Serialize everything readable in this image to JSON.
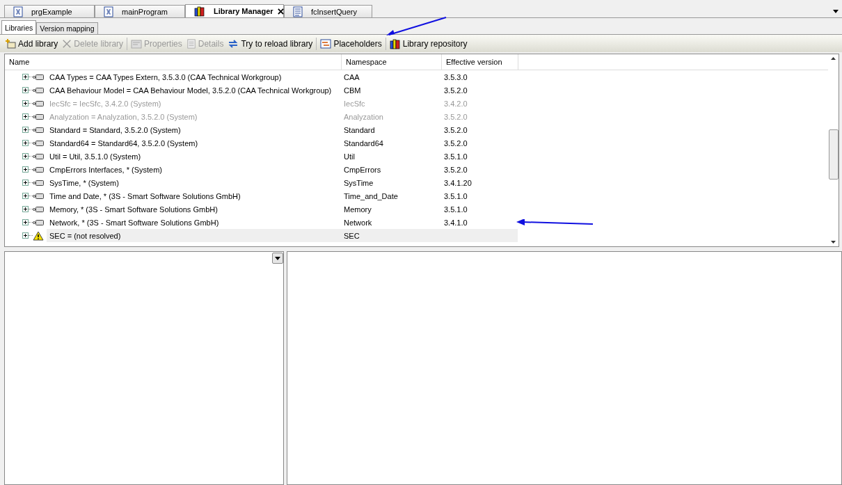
{
  "editor_tabs": [
    {
      "label": "prgExample",
      "kind": "program",
      "selected": false
    },
    {
      "label": "mainProgram",
      "kind": "program",
      "selected": false
    },
    {
      "label": "Library Manager",
      "kind": "library",
      "selected": true
    },
    {
      "label": "fcInsertQuery",
      "kind": "document",
      "selected": false
    }
  ],
  "sub_tabs": [
    {
      "label": "Libraries",
      "selected": true
    },
    {
      "label": "Version mapping",
      "selected": false
    }
  ],
  "toolbar": [
    {
      "label": "Add library",
      "kind": "add",
      "disabled": false
    },
    {
      "label": "Delete library",
      "kind": "delete",
      "disabled": true
    },
    {
      "label": "Properties",
      "kind": "properties",
      "disabled": true
    },
    {
      "label": "Details",
      "kind": "details",
      "disabled": true
    },
    {
      "label": "Try to reload library",
      "kind": "reload",
      "disabled": false
    },
    {
      "label": "Placeholders",
      "kind": "placeholders",
      "disabled": false
    },
    {
      "label": "Library repository",
      "kind": "repository",
      "disabled": false
    }
  ],
  "table": {
    "columns": [
      "Name",
      "Namespace",
      "Effective version"
    ],
    "rows": [
      {
        "name": "CAA Types = CAA Types Extern, 3.5.3.0 (CAA Technical Workgroup)",
        "namespace": "CAA",
        "version": "3.5.3.0",
        "kind": "library",
        "disabled": false,
        "selected": false
      },
      {
        "name": "CAA Behaviour Model = CAA Behaviour Model, 3.5.2.0 (CAA Technical Workgroup)",
        "namespace": "CBM",
        "version": "3.5.2.0",
        "kind": "library",
        "disabled": false,
        "selected": false
      },
      {
        "name": "IecSfc = IecSfc, 3.4.2.0 (System)",
        "namespace": "IecSfc",
        "version": "3.4.2.0",
        "kind": "library",
        "disabled": true,
        "selected": false
      },
      {
        "name": "Analyzation = Analyzation, 3.5.2.0 (System)",
        "namespace": "Analyzation",
        "version": "3.5.2.0",
        "kind": "library",
        "disabled": true,
        "selected": false
      },
      {
        "name": "Standard = Standard, 3.5.2.0 (System)",
        "namespace": "Standard",
        "version": "3.5.2.0",
        "kind": "library",
        "disabled": false,
        "selected": false
      },
      {
        "name": "Standard64 = Standard64, 3.5.2.0 (System)",
        "namespace": "Standard64",
        "version": "3.5.2.0",
        "kind": "library",
        "disabled": false,
        "selected": false
      },
      {
        "name": "Util = Util, 3.5.1.0 (System)",
        "namespace": "Util",
        "version": "3.5.1.0",
        "kind": "library",
        "disabled": false,
        "selected": false
      },
      {
        "name": "CmpErrors Interfaces, * (System)",
        "namespace": "CmpErrors",
        "version": "3.5.2.0",
        "kind": "library",
        "disabled": false,
        "selected": false
      },
      {
        "name": "SysTime, * (System)",
        "namespace": "SysTime",
        "version": "3.4.1.20",
        "kind": "library",
        "disabled": false,
        "selected": false
      },
      {
        "name": "Time and Date, * (3S - Smart Software Solutions GmbH)",
        "namespace": "Time_and_Date",
        "version": "3.5.1.0",
        "kind": "library",
        "disabled": false,
        "selected": false
      },
      {
        "name": "Memory, * (3S - Smart Software Solutions GmbH)",
        "namespace": "Memory",
        "version": "3.5.1.0",
        "kind": "library",
        "disabled": false,
        "selected": false
      },
      {
        "name": "Network, * (3S - Smart Software Solutions GmbH)",
        "namespace": "Network",
        "version": "3.4.1.0",
        "kind": "library",
        "disabled": false,
        "selected": false
      },
      {
        "name": "SEC = (not resolved)",
        "namespace": "SEC",
        "version": "",
        "kind": "unresolved",
        "disabled": false,
        "selected": true
      }
    ]
  }
}
